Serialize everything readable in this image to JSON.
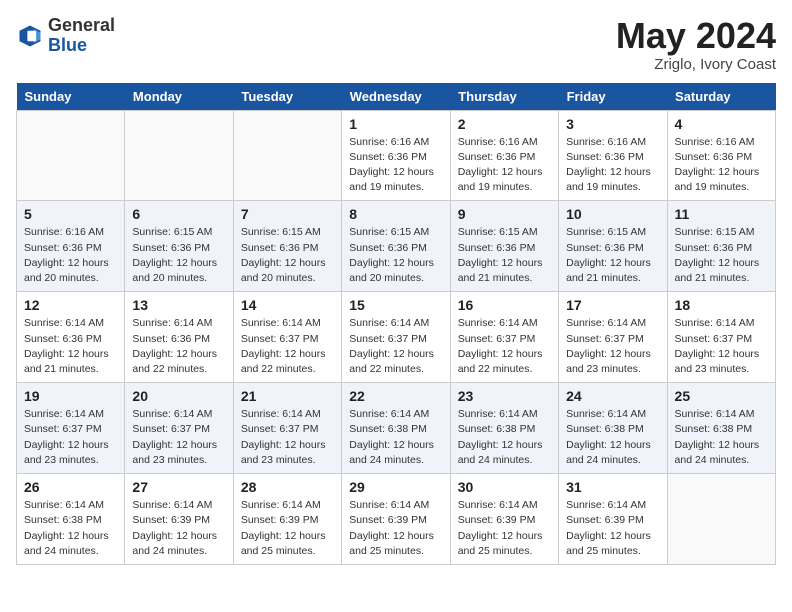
{
  "header": {
    "logo_general": "General",
    "logo_blue": "Blue",
    "month": "May 2024",
    "location": "Zriglo, Ivory Coast"
  },
  "weekdays": [
    "Sunday",
    "Monday",
    "Tuesday",
    "Wednesday",
    "Thursday",
    "Friday",
    "Saturday"
  ],
  "weeks": [
    [
      {
        "day": "",
        "info": ""
      },
      {
        "day": "",
        "info": ""
      },
      {
        "day": "",
        "info": ""
      },
      {
        "day": "1",
        "info": "Sunrise: 6:16 AM\nSunset: 6:36 PM\nDaylight: 12 hours\nand 19 minutes."
      },
      {
        "day": "2",
        "info": "Sunrise: 6:16 AM\nSunset: 6:36 PM\nDaylight: 12 hours\nand 19 minutes."
      },
      {
        "day": "3",
        "info": "Sunrise: 6:16 AM\nSunset: 6:36 PM\nDaylight: 12 hours\nand 19 minutes."
      },
      {
        "day": "4",
        "info": "Sunrise: 6:16 AM\nSunset: 6:36 PM\nDaylight: 12 hours\nand 19 minutes."
      }
    ],
    [
      {
        "day": "5",
        "info": "Sunrise: 6:16 AM\nSunset: 6:36 PM\nDaylight: 12 hours\nand 20 minutes."
      },
      {
        "day": "6",
        "info": "Sunrise: 6:15 AM\nSunset: 6:36 PM\nDaylight: 12 hours\nand 20 minutes."
      },
      {
        "day": "7",
        "info": "Sunrise: 6:15 AM\nSunset: 6:36 PM\nDaylight: 12 hours\nand 20 minutes."
      },
      {
        "day": "8",
        "info": "Sunrise: 6:15 AM\nSunset: 6:36 PM\nDaylight: 12 hours\nand 20 minutes."
      },
      {
        "day": "9",
        "info": "Sunrise: 6:15 AM\nSunset: 6:36 PM\nDaylight: 12 hours\nand 21 minutes."
      },
      {
        "day": "10",
        "info": "Sunrise: 6:15 AM\nSunset: 6:36 PM\nDaylight: 12 hours\nand 21 minutes."
      },
      {
        "day": "11",
        "info": "Sunrise: 6:15 AM\nSunset: 6:36 PM\nDaylight: 12 hours\nand 21 minutes."
      }
    ],
    [
      {
        "day": "12",
        "info": "Sunrise: 6:14 AM\nSunset: 6:36 PM\nDaylight: 12 hours\nand 21 minutes."
      },
      {
        "day": "13",
        "info": "Sunrise: 6:14 AM\nSunset: 6:36 PM\nDaylight: 12 hours\nand 22 minutes."
      },
      {
        "day": "14",
        "info": "Sunrise: 6:14 AM\nSunset: 6:37 PM\nDaylight: 12 hours\nand 22 minutes."
      },
      {
        "day": "15",
        "info": "Sunrise: 6:14 AM\nSunset: 6:37 PM\nDaylight: 12 hours\nand 22 minutes."
      },
      {
        "day": "16",
        "info": "Sunrise: 6:14 AM\nSunset: 6:37 PM\nDaylight: 12 hours\nand 22 minutes."
      },
      {
        "day": "17",
        "info": "Sunrise: 6:14 AM\nSunset: 6:37 PM\nDaylight: 12 hours\nand 23 minutes."
      },
      {
        "day": "18",
        "info": "Sunrise: 6:14 AM\nSunset: 6:37 PM\nDaylight: 12 hours\nand 23 minutes."
      }
    ],
    [
      {
        "day": "19",
        "info": "Sunrise: 6:14 AM\nSunset: 6:37 PM\nDaylight: 12 hours\nand 23 minutes."
      },
      {
        "day": "20",
        "info": "Sunrise: 6:14 AM\nSunset: 6:37 PM\nDaylight: 12 hours\nand 23 minutes."
      },
      {
        "day": "21",
        "info": "Sunrise: 6:14 AM\nSunset: 6:37 PM\nDaylight: 12 hours\nand 23 minutes."
      },
      {
        "day": "22",
        "info": "Sunrise: 6:14 AM\nSunset: 6:38 PM\nDaylight: 12 hours\nand 24 minutes."
      },
      {
        "day": "23",
        "info": "Sunrise: 6:14 AM\nSunset: 6:38 PM\nDaylight: 12 hours\nand 24 minutes."
      },
      {
        "day": "24",
        "info": "Sunrise: 6:14 AM\nSunset: 6:38 PM\nDaylight: 12 hours\nand 24 minutes."
      },
      {
        "day": "25",
        "info": "Sunrise: 6:14 AM\nSunset: 6:38 PM\nDaylight: 12 hours\nand 24 minutes."
      }
    ],
    [
      {
        "day": "26",
        "info": "Sunrise: 6:14 AM\nSunset: 6:38 PM\nDaylight: 12 hours\nand 24 minutes."
      },
      {
        "day": "27",
        "info": "Sunrise: 6:14 AM\nSunset: 6:39 PM\nDaylight: 12 hours\nand 24 minutes."
      },
      {
        "day": "28",
        "info": "Sunrise: 6:14 AM\nSunset: 6:39 PM\nDaylight: 12 hours\nand 25 minutes."
      },
      {
        "day": "29",
        "info": "Sunrise: 6:14 AM\nSunset: 6:39 PM\nDaylight: 12 hours\nand 25 minutes."
      },
      {
        "day": "30",
        "info": "Sunrise: 6:14 AM\nSunset: 6:39 PM\nDaylight: 12 hours\nand 25 minutes."
      },
      {
        "day": "31",
        "info": "Sunrise: 6:14 AM\nSunset: 6:39 PM\nDaylight: 12 hours\nand 25 minutes."
      },
      {
        "day": "",
        "info": ""
      }
    ]
  ]
}
